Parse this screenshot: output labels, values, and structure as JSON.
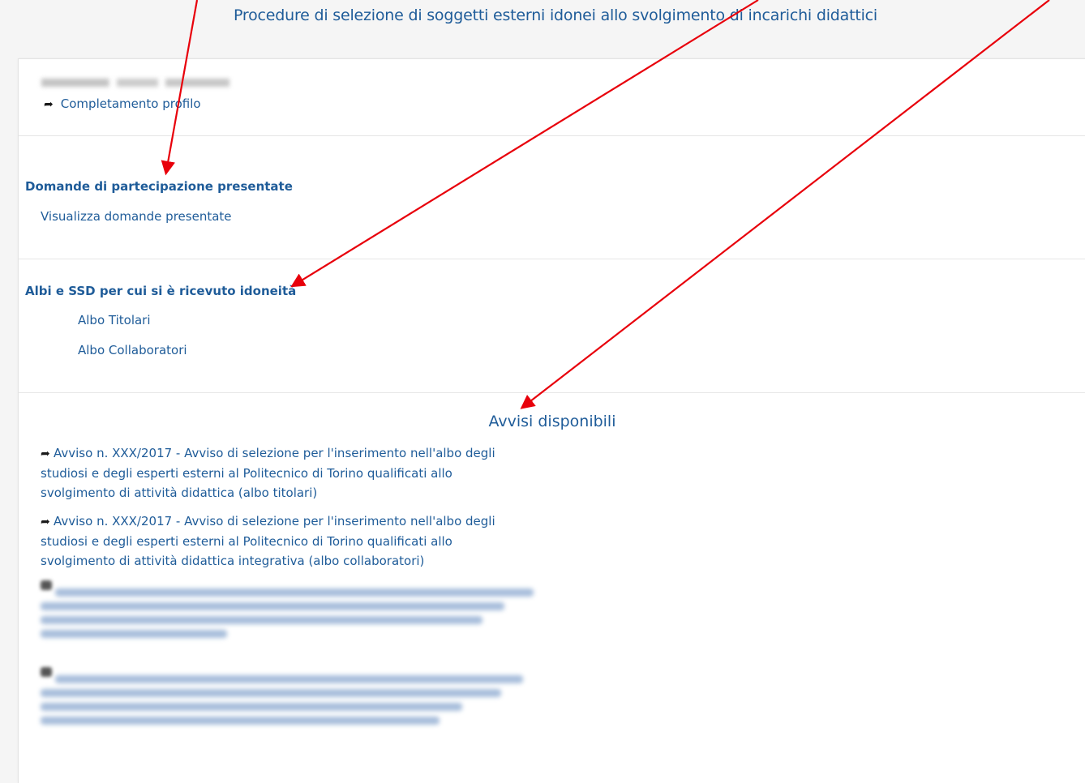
{
  "page": {
    "title": "Procedure di selezione di soggetti esterni idonei allo svolgimento di incarichi didattici"
  },
  "profile": {
    "link_label": "Completamento profilo",
    "arrow_icon": "share-arrow-icon"
  },
  "applications": {
    "heading": "Domande di partecipazione presentate",
    "view_link": "Visualizza domande presentate"
  },
  "albo": {
    "heading": "Albi e SSD per cui si è ricevuto idoneità",
    "items": [
      "Albo Titolari",
      "Albo Collaboratori"
    ]
  },
  "avvisi": {
    "heading": "Avvisi disponibili",
    "notices": [
      {
        "lines": [
          "Avviso n. XXX/2017 - Avviso di selezione per l'inserimento nell'albo degli",
          "studiosi e degli esperti esterni al Politecnico di Torino qualificati allo",
          "svolgimento di attività didattica (albo titolari)"
        ]
      },
      {
        "lines": [
          "Avviso n. XXX/2017 - Avviso di selezione per l'inserimento nell'albo degli",
          "studiosi e degli esperti esterni al Politecnico di Torino qualificati allo",
          "svolgimento di attività didattica integrativa (albo collaboratori)"
        ]
      }
    ]
  },
  "colors": {
    "link": "#1f5c99",
    "annotation_arrow": "#e8000b"
  }
}
